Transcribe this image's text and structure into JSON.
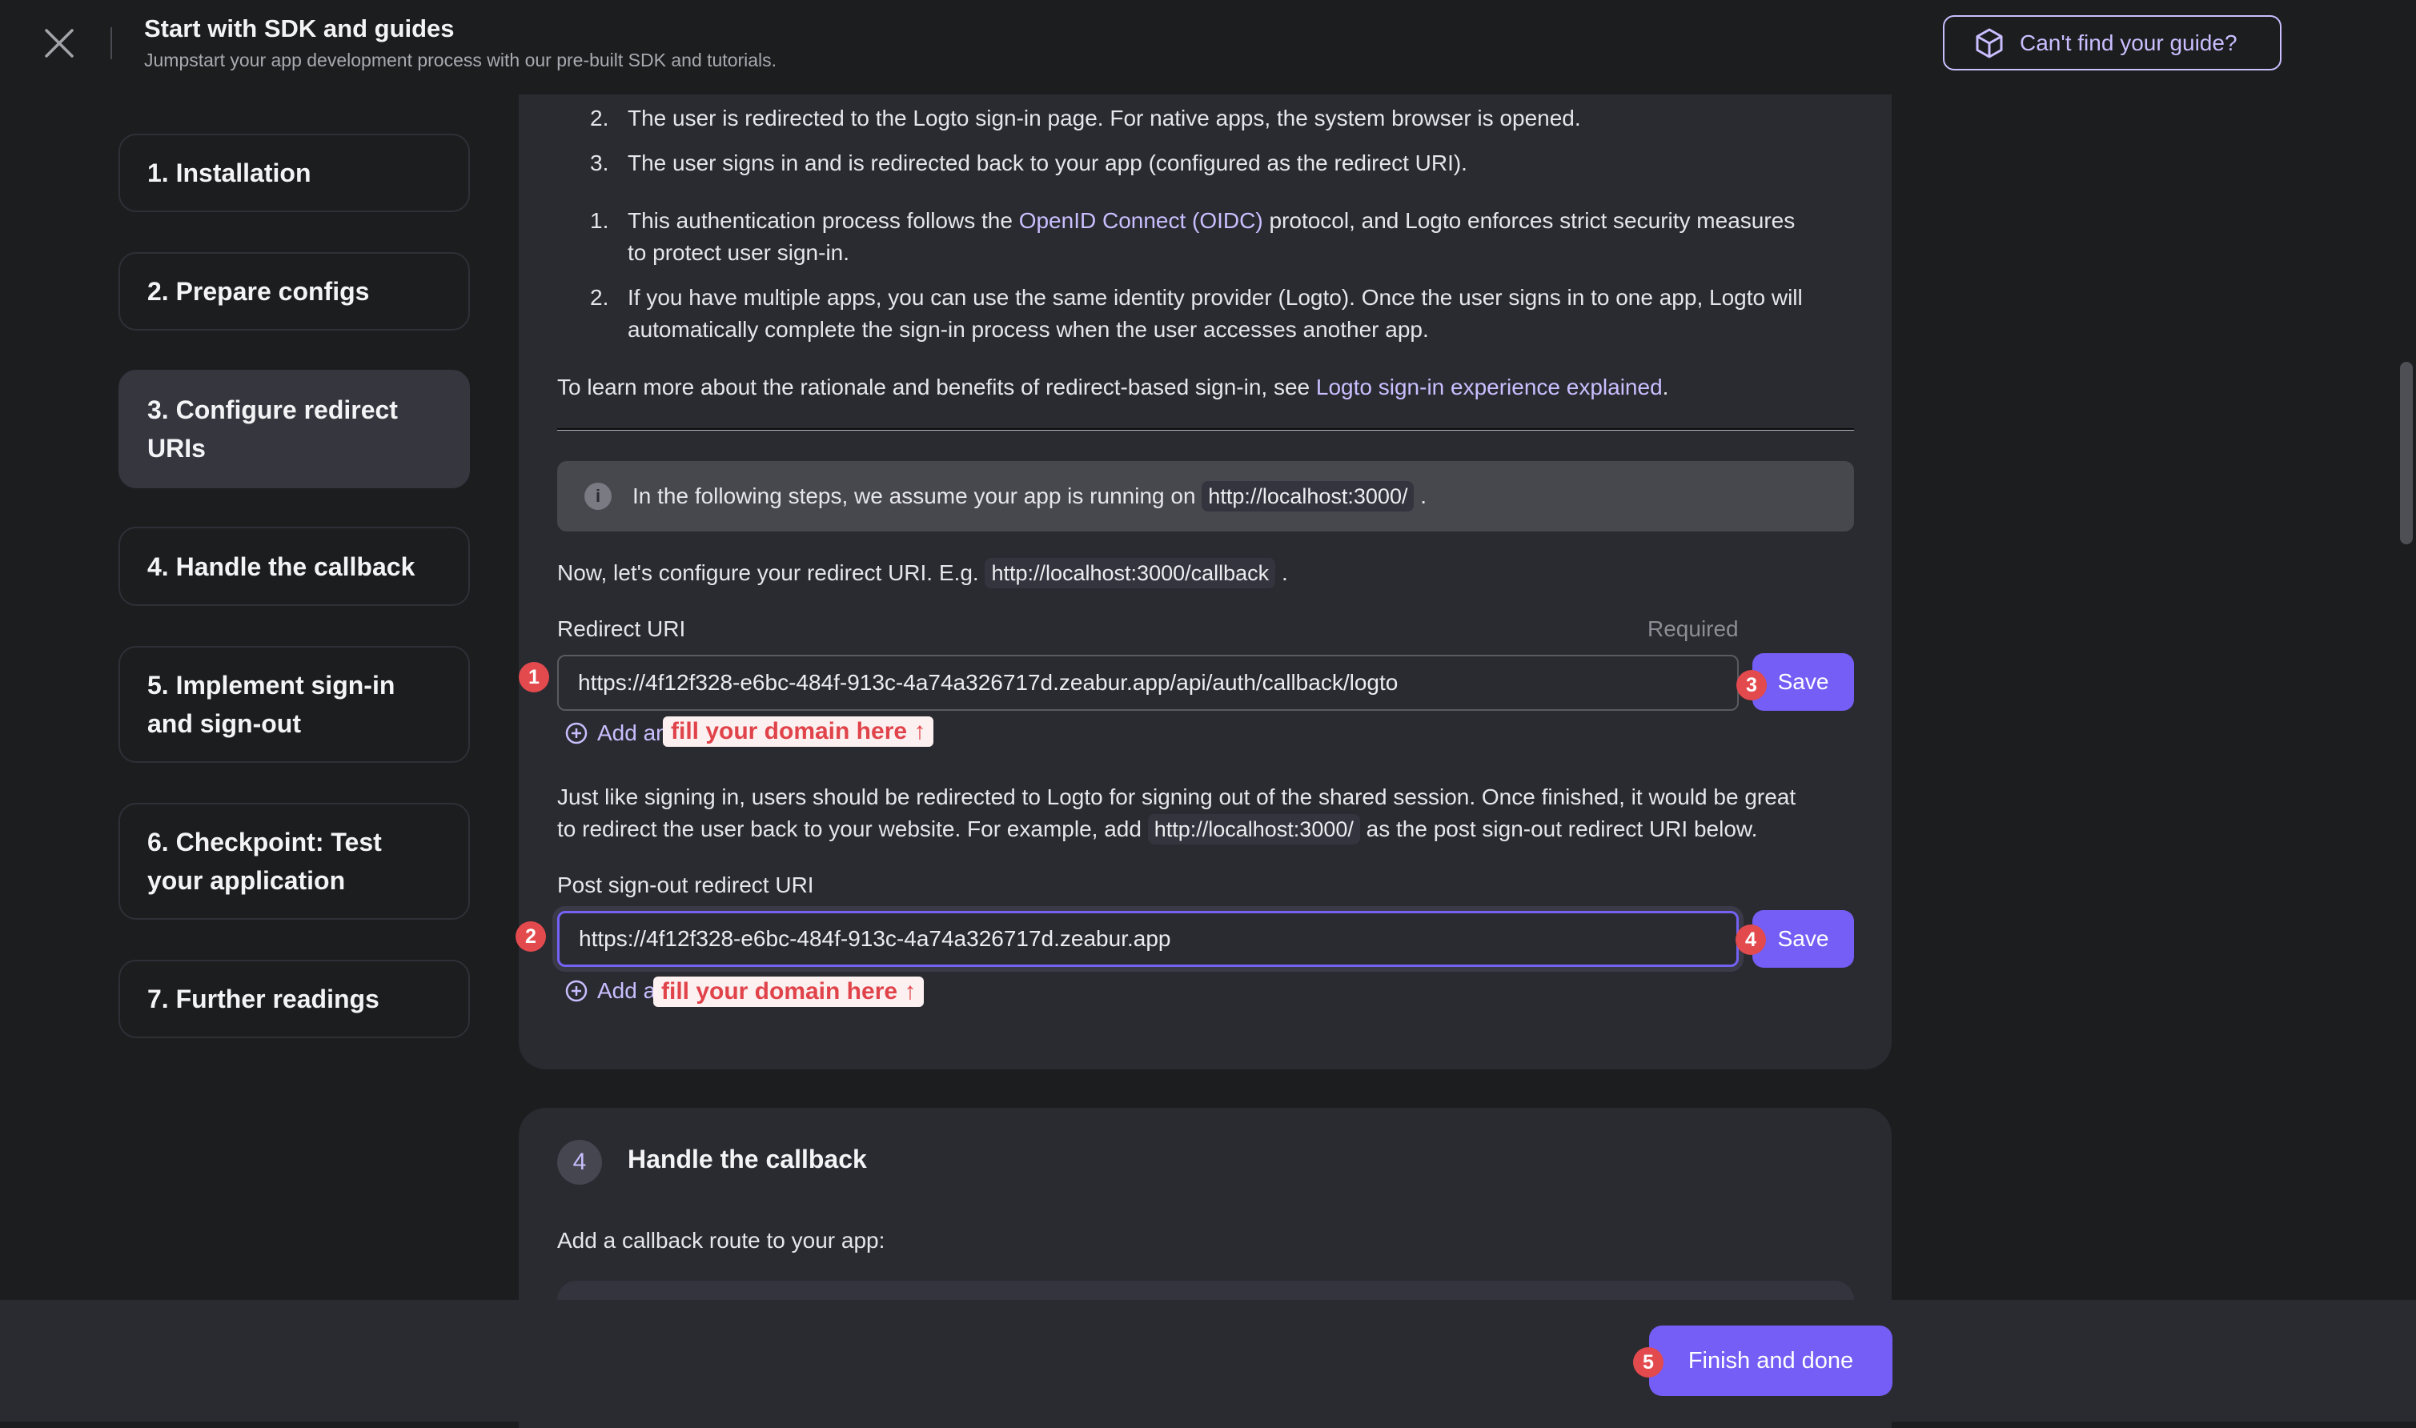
{
  "header": {
    "title": "Start with SDK and guides",
    "subtitle": "Jumpstart your app development process with our pre-built SDK and tutorials.",
    "guide_button": "Can't find your guide?"
  },
  "sidebar": {
    "items": [
      {
        "label": "1. Installation",
        "active": false
      },
      {
        "label": "2. Prepare configs",
        "active": false
      },
      {
        "label": "3. Configure redirect URIs",
        "active": true
      },
      {
        "label": "4. Handle the callback",
        "active": false
      },
      {
        "label": "5. Implement sign-in and sign-out",
        "active": false
      },
      {
        "label": "6. Checkpoint: Test your application",
        "active": false
      },
      {
        "label": "7. Further readings",
        "active": false
      }
    ]
  },
  "content": {
    "flow_list": [
      {
        "num": "2.",
        "text": "The user is redirected to the Logto sign-in page. For native apps, the system browser is opened."
      },
      {
        "num": "3.",
        "text": "The user signs in and is redirected back to your app (configured as the redirect URI)."
      }
    ],
    "notes": [
      {
        "num": "1.",
        "pre": "This authentication process follows the ",
        "link": "OpenID Connect (OIDC)",
        "post": " protocol, and Logto enforces strict security measures",
        "line2": "to protect user sign-in."
      },
      {
        "num": "2.",
        "line1": "If you have multiple apps, you can use the same identity provider (Logto). Once the user signs in to one app, Logto will",
        "line2": "automatically complete the sign-in process when the user accesses another app."
      }
    ],
    "learn_more": {
      "pre": "To learn more about the rationale and benefits of redirect-based sign-in, see ",
      "link": "Logto sign-in experience explained",
      "post": "."
    },
    "info": {
      "pre": "In the following steps, we assume your app is running on",
      "code": "http://localhost:3000/",
      "post": "."
    },
    "configure": {
      "pre": "Now, let's configure your redirect URI. E.g.",
      "code": "http://localhost:3000/callback",
      "post": "."
    },
    "redirect_uri": {
      "label": "Redirect URI",
      "required": "Required",
      "value": "https://4f12f328-e6bc-484f-913c-4a74a326717d.zeabur.app/api/auth/callback/logto",
      "save": "Save",
      "add_another": "Add another",
      "annotation": "fill your domain here ↑"
    },
    "signout_para": {
      "line1": "Just like signing in, users should be redirected to Logto for signing out of the shared session. Once finished, it would be great",
      "pre2": "to redirect the user back to your website. For example, add",
      "code": "http://localhost:3000/",
      "post2": "as the post sign-out redirect URI below."
    },
    "post_signout_uri": {
      "label": "Post sign-out redirect URI",
      "value": "https://4f12f328-e6bc-484f-913c-4a74a326717d.zeabur.app",
      "save": "Save",
      "add_another": "Add another",
      "annotation": "fill your domain here ↑"
    },
    "next_step": {
      "number": "4",
      "title": "Handle the callback",
      "intro": "Add a callback route to your app:"
    }
  },
  "annotations": {
    "badge1": "1",
    "badge2": "2",
    "badge3": "3",
    "badge4": "4",
    "badge5": "5"
  },
  "footer": {
    "finish": "Finish and done"
  },
  "colors": {
    "accent": "#745ef5",
    "link": "#cabeff",
    "annotation_red": "#e24a4e",
    "active_sidebar": "#36363f"
  }
}
